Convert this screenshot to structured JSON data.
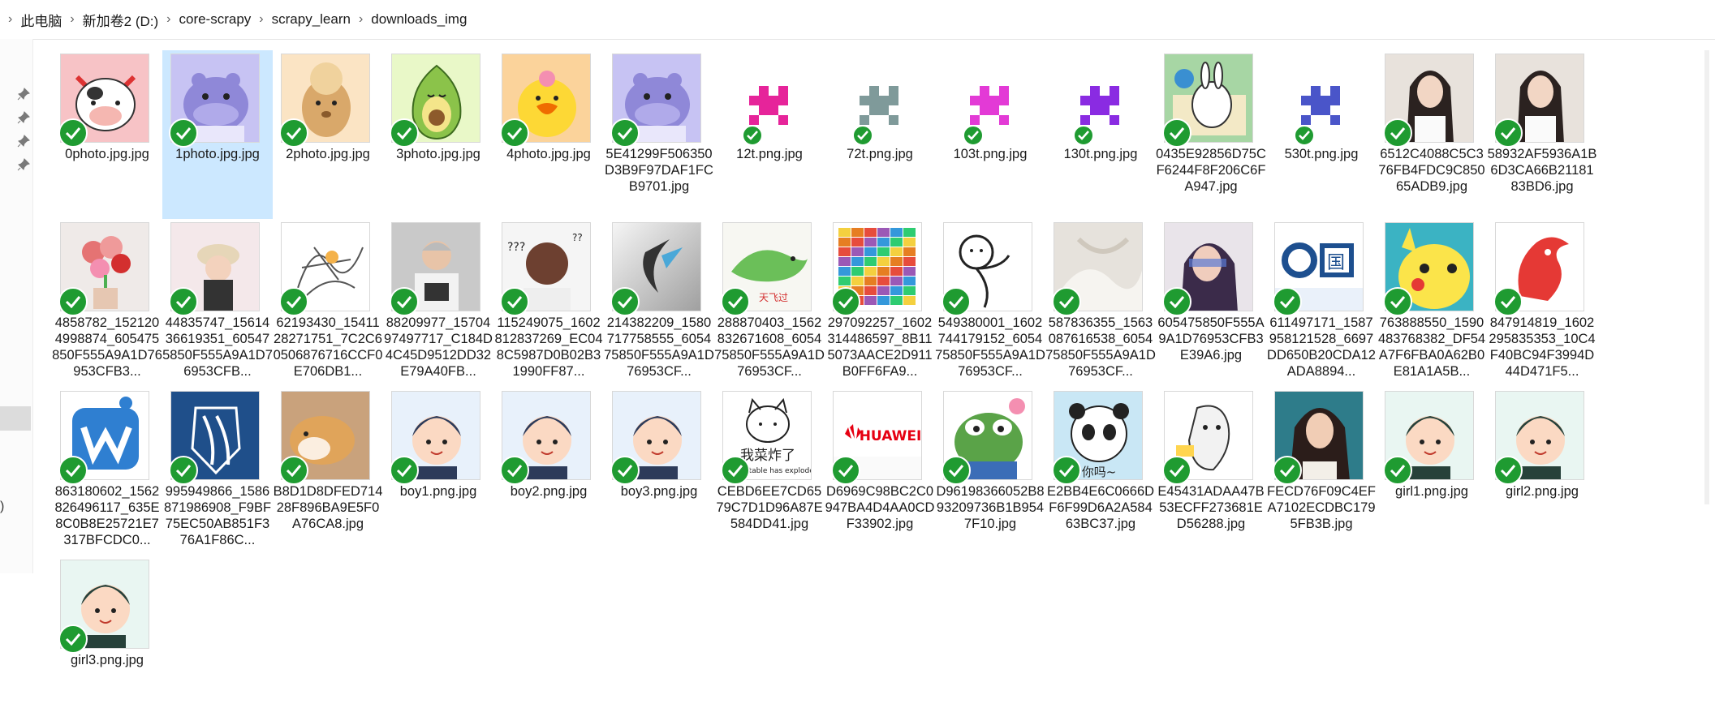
{
  "breadcrumb": {
    "items": [
      "此电脑",
      "新加卷2 (D:)",
      "core-scrapy",
      "scrapy_learn",
      "downloads_img"
    ]
  },
  "nav_pane": {
    "partial_text": ")"
  },
  "files": [
    {
      "name": "0photo.jpg.jpg",
      "icon": "cow-avatar-icon"
    },
    {
      "name": "1photo.jpg.jpg",
      "icon": "hippo-avatar-icon",
      "selected": true
    },
    {
      "name": "2photo.jpg.jpg",
      "icon": "alpaca-avatar-icon"
    },
    {
      "name": "3photo.jpg.jpg",
      "icon": "avocado-avatar-icon"
    },
    {
      "name": "4photo.jpg.jpg",
      "icon": "chick-avatar-icon"
    },
    {
      "name": "5E41299F506350D3B9F97DAF1FCB9701.jpg",
      "icon": "hippo-avatar-icon"
    },
    {
      "name": "12t.png.jpg",
      "icon": "pixel-magenta-icon"
    },
    {
      "name": "72t.png.jpg",
      "icon": "pixel-gray-icon"
    },
    {
      "name": "103t.png.jpg",
      "icon": "pixel-pink-icon"
    },
    {
      "name": "130t.png.jpg",
      "icon": "pixel-purple-icon"
    },
    {
      "name": "0435E92856D75CF6244F8F206C6FA947.jpg",
      "icon": "cartoon-rabbit-icon"
    },
    {
      "name": "530t.png.jpg",
      "icon": "pixel-blue-icon"
    },
    {
      "name": "6512C4088C5C376FB4FDC9C85065ADB9.jpg",
      "icon": "girl-photo-icon"
    },
    {
      "name": "58932AF5936A1B6D3CA66B2118183BD6.jpg",
      "icon": "girl-photo-icon"
    },
    {
      "name": "4858782_1521204998874_605475850F555A9A1D76953CFB3...",
      "icon": "flowers-photo-icon"
    },
    {
      "name": "44835747_1561436619351_605475850F555A9A1D76953CFB...",
      "icon": "child-photo-icon"
    },
    {
      "name": "62193430_1541128271751_7C2C60506876716CCF0E706DB1...",
      "icon": "sketch-drawing-icon"
    },
    {
      "name": "88209977_1570497497717_C184D4C45D9512DD32E79A40FB...",
      "icon": "man-photo-icon"
    },
    {
      "name": "115249075_1602812837269_EC048C5987D0B02B31990FF87...",
      "icon": "meme-man-icon"
    },
    {
      "name": "214382209_1580717758555_605475850F555A9A1D76953CF...",
      "icon": "abstract-logo-icon"
    },
    {
      "name": "288870403_1562832671608_605475850F555A9A1D76953CF...",
      "icon": "green-bird-icon"
    },
    {
      "name": "297092257_1602314486597_8B115073AACE2D911B0FF6FA9...",
      "icon": "color-grid-icon"
    },
    {
      "name": "549380001_1602744179152_605475850F555A9A1D76953CF...",
      "icon": "stick-figure-icon"
    },
    {
      "name": "587836355_1563087616538_605475850F555A9A1D76953CF...",
      "icon": "fabric-photo-icon"
    },
    {
      "name": "605475850F555A9A1D76953CFB3E39A6.jpg",
      "icon": "woman-portrait-icon"
    },
    {
      "name": "611497171_1587958121528_6697DD650B20CDA12ADA8894...",
      "icon": "blue-logo-icon"
    },
    {
      "name": "763888550_1590483768382_DF54A7F6FBA0A62B0E81A1A5B...",
      "icon": "pikachu-icon"
    },
    {
      "name": "847914819_1602295835353_10C4F40BC94F3994D44D471F5...",
      "icon": "red-horse-logo-icon"
    },
    {
      "name": "863180602_1562826496117_635E8C0B8E25721E7317BFCDC0...",
      "icon": "blue-app-logo-icon"
    },
    {
      "name": "995949866_1586871986908_F9BF75EC50AB851F376A1F86C...",
      "icon": "wings-emblem-icon"
    },
    {
      "name": "B8D1D8DFED71428F896BA9E5F0A76CA8.jpg",
      "icon": "dog-photo-icon"
    },
    {
      "name": "boy1.png.jpg",
      "icon": "boy-avatar-icon"
    },
    {
      "name": "boy2.png.jpg",
      "icon": "boy-avatar-icon"
    },
    {
      "name": "boy3.png.jpg",
      "icon": "boy-avatar-icon"
    },
    {
      "name": "CEBD6EE7CD6579C7D1D96A87E584DD41.jpg",
      "icon": "cat-meme-icon",
      "caption": "我菜炸了",
      "caption2": "my vegetable has exploded"
    },
    {
      "name": "D6969C98BC2C0947BA4D4AA0CDF33902.jpg",
      "icon": "huawei-logo-icon",
      "caption": "HUAWEI"
    },
    {
      "name": "D96198366052B893209736B1B9547F10.jpg",
      "icon": "frog-meme-icon"
    },
    {
      "name": "E2BB4E6C0666DF6F99D6A2A58463BC37.jpg",
      "icon": "panda-meme-icon",
      "caption": "你吗~"
    },
    {
      "name": "E45431ADAA47B53ECFF273681ED56288.jpg",
      "icon": "meme-sketch-icon"
    },
    {
      "name": "FECD76F09C4EFA7102ECDBC1795FB3B.jpg",
      "icon": "girl-illustration-icon"
    },
    {
      "name": "girl1.png.jpg",
      "icon": "girl-avatar-icon"
    },
    {
      "name": "girl2.png.jpg",
      "icon": "girl-avatar-icon"
    },
    {
      "name": "girl3.png.jpg",
      "icon": "girl-avatar-icon"
    }
  ],
  "colors": {
    "selection": "#cce8ff",
    "sync_check": "#1f9b31"
  }
}
